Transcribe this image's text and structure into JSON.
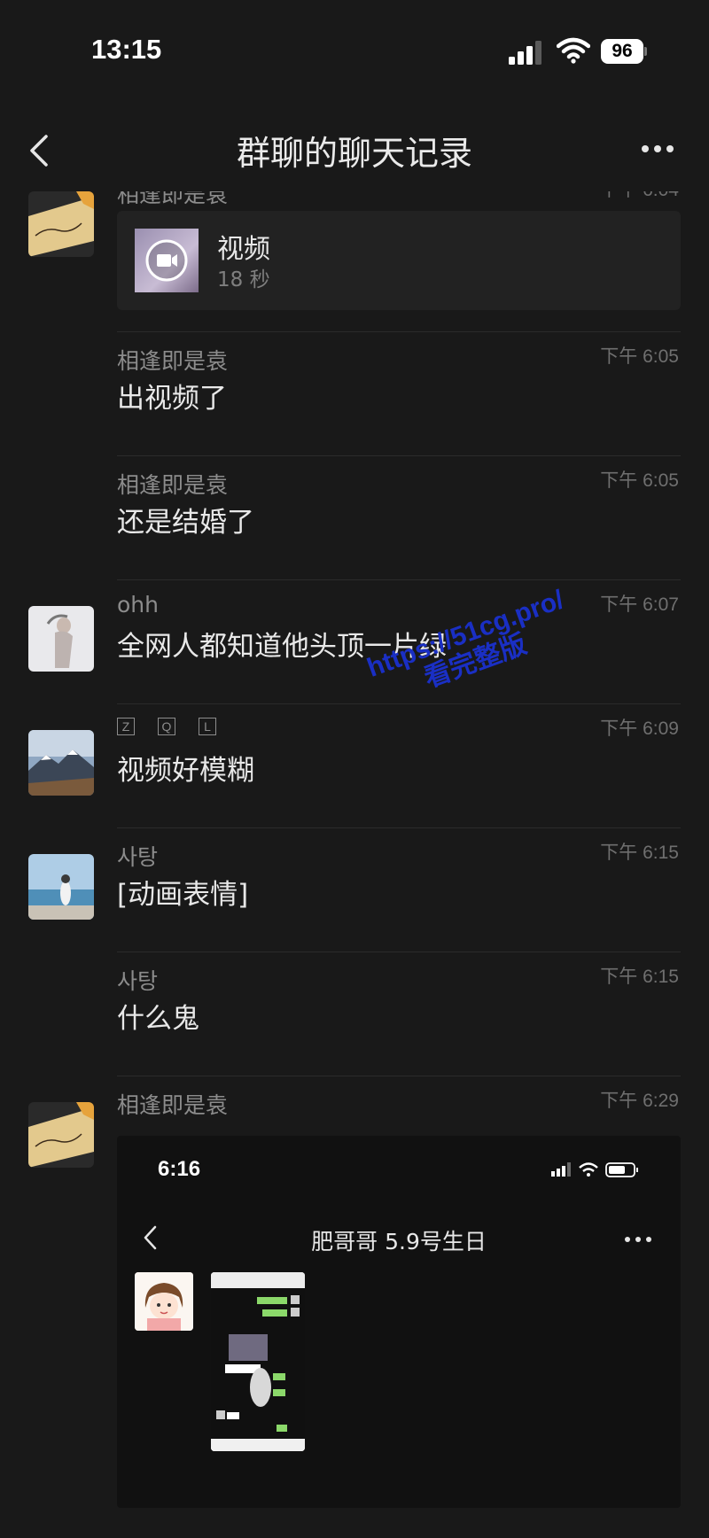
{
  "status_bar": {
    "time": "13:15",
    "battery": "96"
  },
  "nav": {
    "title": "群聊的聊天记录"
  },
  "messages": [
    {
      "sender": "相逢即是袁",
      "time": "下午 6:04",
      "video": {
        "title": "视频",
        "duration": "18 秒"
      }
    },
    {
      "sender": "相逢即是袁",
      "time": "下午 6:05",
      "text": "出视频了"
    },
    {
      "sender": "相逢即是袁",
      "time": "下午 6:05",
      "text": "还是结婚了"
    },
    {
      "sender": "ohh",
      "time": "下午 6:07",
      "text": "全网人都知道他头顶一片绿"
    },
    {
      "sender_letters": [
        "Z",
        "Q",
        "L"
      ],
      "time": "下午 6:09",
      "text": "视频好模糊"
    },
    {
      "sender": "사탕",
      "time": "下午 6:15",
      "text": "[动画表情]"
    },
    {
      "sender": "사탕",
      "time": "下午 6:15",
      "text": "什么鬼"
    },
    {
      "sender": "相逢即是袁",
      "time": "下午 6:29",
      "screenshot": {
        "time": "6:16",
        "title": "肥哥哥 5.9号生日"
      }
    }
  ],
  "watermark": {
    "line1": "https://51cg.pro/",
    "line2": "看完整版"
  }
}
